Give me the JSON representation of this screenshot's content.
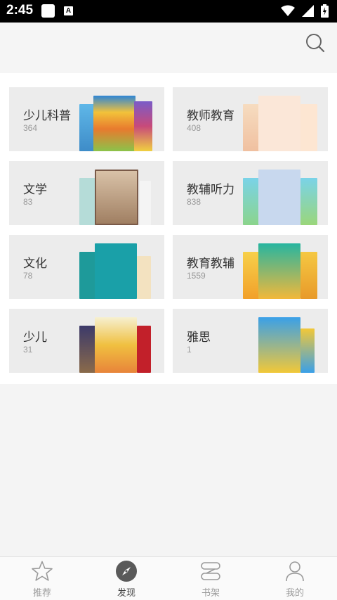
{
  "status_bar": {
    "time": "2:45"
  },
  "header": {
    "search_icon": "search-icon"
  },
  "categories": [
    {
      "title": "少儿科普",
      "count": "364"
    },
    {
      "title": "教师教育",
      "count": "408"
    },
    {
      "title": "文学",
      "count": "83"
    },
    {
      "title": "教辅听力",
      "count": "838"
    },
    {
      "title": "文化",
      "count": "78"
    },
    {
      "title": "教育教辅",
      "count": "1559"
    },
    {
      "title": "少儿",
      "count": "31"
    },
    {
      "title": "雅思",
      "count": "1"
    }
  ],
  "bottom_nav": [
    {
      "label": "推荐",
      "icon": "star-icon",
      "active": false
    },
    {
      "label": "发现",
      "icon": "compass-icon",
      "active": true
    },
    {
      "label": "书架",
      "icon": "bookshelf-icon",
      "active": false
    },
    {
      "label": "我的",
      "icon": "person-icon",
      "active": false
    }
  ],
  "colors": {
    "active_nav": "#5a5a5a",
    "inactive_nav": "#9a9a9a",
    "card_bg": "#ececec"
  }
}
